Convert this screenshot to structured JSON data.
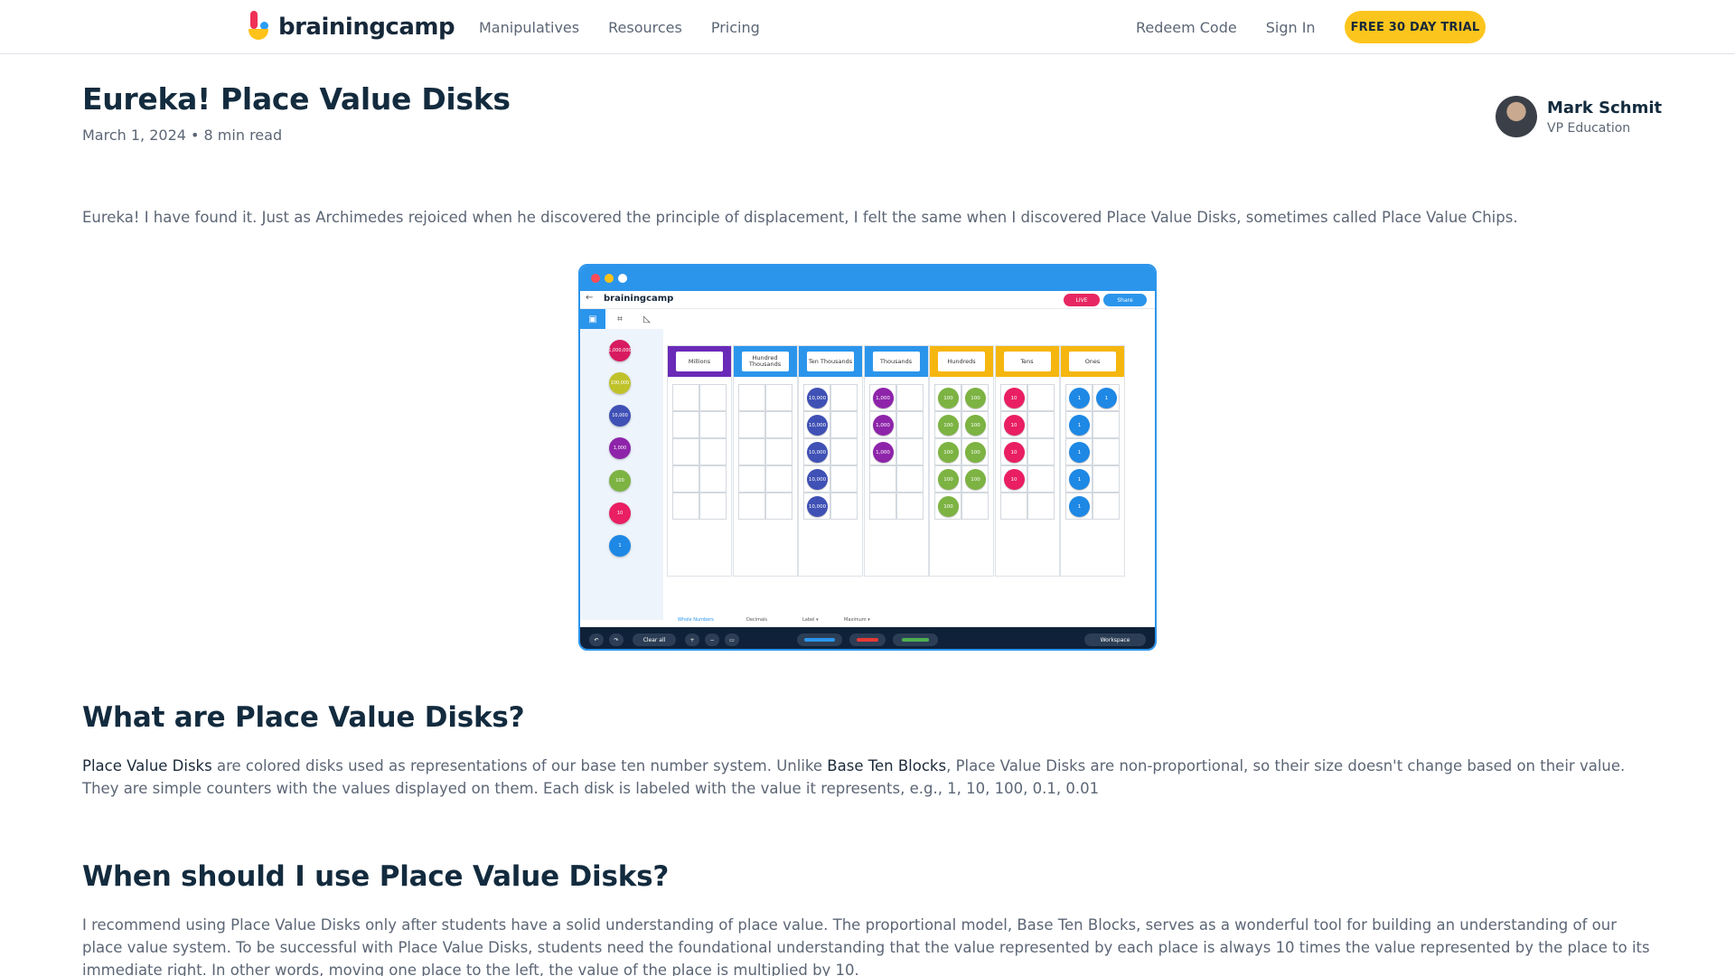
{
  "brand": {
    "name": "brainingcamp"
  },
  "nav": {
    "left": [
      "Manipulatives",
      "Resources",
      "Pricing"
    ],
    "right": [
      "Redeem Code",
      "Sign In"
    ],
    "cta": "FREE 30 DAY TRIAL"
  },
  "article": {
    "title": "Eureka! Place Value Disks",
    "meta": "March 1, 2024 • 8 min read",
    "author": {
      "name": "Mark Schmit",
      "role": "VP Education"
    },
    "intro": "Eureka! I have found it. Just as Archimedes rejoiced when he discovered the principle of displacement, I felt the same when I discovered Place Value Disks, sometimes called Place Value Chips.",
    "section1": {
      "heading": "What are Place Value Disks?",
      "link1": "Place Value Disks",
      "text1": " are colored disks used as representations of our base ten number system. Unlike ",
      "link2": "Base Ten Blocks",
      "text2": ", Place Value Disks are non-proportional, so their size doesn't change based on their value. They are simple counters with the values displayed on them. Each disk is labeled with the value it represents, e.g., 1, 10, 100, 0.1, 0.01"
    },
    "section2": {
      "heading": "When should I use Place Value Disks?",
      "text": "I recommend using Place Value Disks only after students have a solid understanding of place value. The proportional model, Base Ten Blocks, serves as a wonderful tool for building an understanding of our place value system. To be successful with Place Value Disks, students need the foundational understanding that the value represented by each place is always 10 times the value represented by the place to its immediate right. In other words, moving one place to the left, the value of the place is multiplied by 10."
    }
  },
  "screenshot": {
    "app_logo": "brainingcamp",
    "live_label": "LIVE",
    "share_label": "Share",
    "side_disks": [
      {
        "label": "1,000,000",
        "color": "#d81b60"
      },
      {
        "label": "100,000",
        "color": "#c0c22a"
      },
      {
        "label": "10,000",
        "color": "#3f51b5"
      },
      {
        "label": "1,000",
        "color": "#8e24aa"
      },
      {
        "label": "100",
        "color": "#7cb342"
      },
      {
        "label": "10",
        "color": "#e91e63"
      },
      {
        "label": "1",
        "color": "#1e88e5"
      }
    ],
    "columns": [
      {
        "label": "Millions",
        "header_color": "#6a2ab8",
        "count": 0,
        "disk_label": "1,000,000",
        "disk_color": "#d81b60"
      },
      {
        "label": "Hundred Thousands",
        "header_color": "#2b95ec",
        "count": 0,
        "disk_label": "100,000",
        "disk_color": "#c0c22a"
      },
      {
        "label": "Ten Thousands",
        "header_color": "#2b95ec",
        "count": 5,
        "disk_label": "10,000",
        "disk_color": "#3f51b5"
      },
      {
        "label": "Thousands",
        "header_color": "#2b95ec",
        "count": 3,
        "disk_label": "1,000",
        "disk_color": "#8e24aa"
      },
      {
        "label": "Hundreds",
        "header_color": "#f5b60f",
        "count": 9,
        "disk_label": "100",
        "disk_color": "#7cb342"
      },
      {
        "label": "Tens",
        "header_color": "#f5b60f",
        "count": 4,
        "disk_label": "10",
        "disk_color": "#e91e63"
      },
      {
        "label": "Ones",
        "header_color": "#f5b60f",
        "count": 6,
        "disk_label": "1",
        "disk_color": "#1e88e5"
      }
    ],
    "subbar": [
      "Whole Numbers",
      "Decimals",
      "Label ▾",
      "Maximum ▾"
    ],
    "bottom": {
      "clear": "Clear all",
      "workspace": "Workspace"
    }
  }
}
